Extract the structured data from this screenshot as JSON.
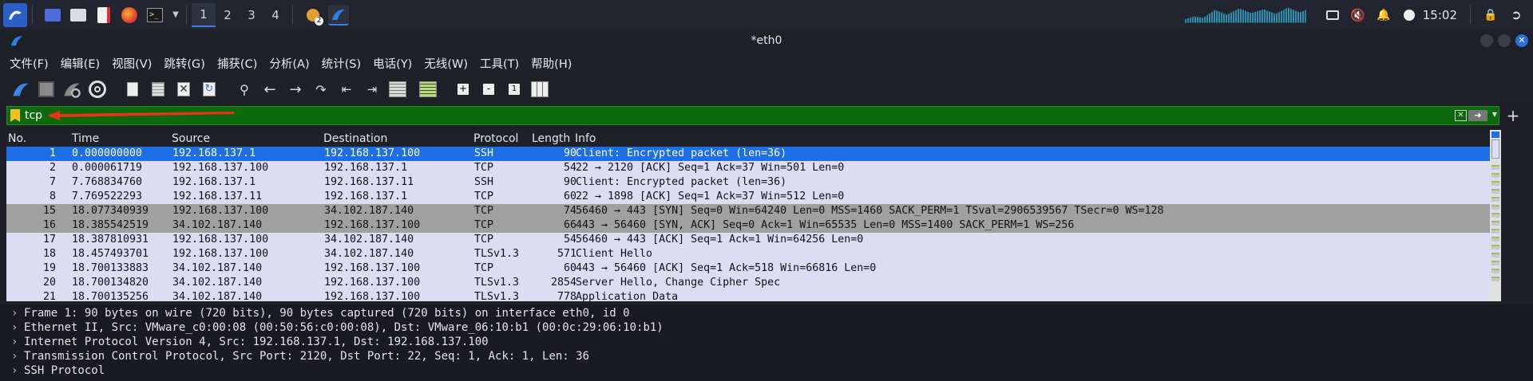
{
  "taskbar": {
    "workspaces": [
      "1",
      "2",
      "3",
      "4"
    ],
    "clock": "15:02",
    "notify_badge": "2"
  },
  "window": {
    "title": "*eth0"
  },
  "menu": [
    "文件(F)",
    "编辑(E)",
    "视图(V)",
    "跳转(G)",
    "捕获(C)",
    "分析(A)",
    "统计(S)",
    "电话(Y)",
    "无线(W)",
    "工具(T)",
    "帮助(H)"
  ],
  "filter": {
    "value": "tcp"
  },
  "columns": [
    "No.",
    "Time",
    "Source",
    "Destination",
    "Protocol",
    "Length",
    "Info"
  ],
  "packets": [
    {
      "no": "1",
      "time": "0.000000000",
      "src": "192.168.137.1",
      "dst": "192.168.137.100",
      "proto": "SSH",
      "len": "90",
      "info": "Client: Encrypted packet (len=36)"
    },
    {
      "no": "2",
      "time": "0.000061719",
      "src": "192.168.137.100",
      "dst": "192.168.137.1",
      "proto": "TCP",
      "len": "54",
      "info": "22 → 2120 [ACK] Seq=1 Ack=37 Win=501 Len=0"
    },
    {
      "no": "7",
      "time": "7.768834760",
      "src": "192.168.137.1",
      "dst": "192.168.137.11",
      "proto": "SSH",
      "len": "90",
      "info": "Client: Encrypted packet (len=36)"
    },
    {
      "no": "8",
      "time": "7.769522293",
      "src": "192.168.137.11",
      "dst": "192.168.137.1",
      "proto": "TCP",
      "len": "60",
      "info": "22 → 1898 [ACK] Seq=1 Ack=37 Win=512 Len=0"
    },
    {
      "no": "15",
      "time": "18.077340939",
      "src": "192.168.137.100",
      "dst": "34.102.187.140",
      "proto": "TCP",
      "len": "74",
      "info": "56460 → 443 [SYN] Seq=0 Win=64240 Len=0 MSS=1460 SACK_PERM=1 TSval=2906539567 TSecr=0 WS=128"
    },
    {
      "no": "16",
      "time": "18.385542519",
      "src": "34.102.187.140",
      "dst": "192.168.137.100",
      "proto": "TCP",
      "len": "66",
      "info": "443 → 56460 [SYN, ACK] Seq=0 Ack=1 Win=65535 Len=0 MSS=1400 SACK_PERM=1 WS=256"
    },
    {
      "no": "17",
      "time": "18.387810931",
      "src": "192.168.137.100",
      "dst": "34.102.187.140",
      "proto": "TCP",
      "len": "54",
      "info": "56460 → 443 [ACK] Seq=1 Ack=1 Win=64256 Len=0"
    },
    {
      "no": "18",
      "time": "18.457493701",
      "src": "192.168.137.100",
      "dst": "34.102.187.140",
      "proto": "TLSv1.3",
      "len": "571",
      "info": "Client Hello"
    },
    {
      "no": "19",
      "time": "18.700133883",
      "src": "34.102.187.140",
      "dst": "192.168.137.100",
      "proto": "TCP",
      "len": "60",
      "info": "443 → 56460 [ACK] Seq=1 Ack=518 Win=66816 Len=0"
    },
    {
      "no": "20",
      "time": "18.700134820",
      "src": "34.102.187.140",
      "dst": "192.168.137.100",
      "proto": "TLSv1.3",
      "len": "2854",
      "info": "Server Hello, Change Cipher Spec"
    },
    {
      "no": "21",
      "time": "18.700135256",
      "src": "34.102.187.140",
      "dst": "192.168.137.100",
      "proto": "TLSv1.3",
      "len": "778",
      "info": "Application Data"
    }
  ],
  "details": [
    "Frame 1: 90 bytes on wire (720 bits), 90 bytes captured (720 bits) on interface eth0, id 0",
    "Ethernet II, Src: VMware_c0:00:08 (00:50:56:c0:00:08), Dst: VMware_06:10:b1 (00:0c:29:06:10:b1)",
    "Internet Protocol Version 4, Src: 192.168.137.1, Dst: 192.168.137.100",
    "Transmission Control Protocol, Src Port: 2120, Dst Port: 22, Seq: 1, Ack: 1, Len: 36",
    "SSH Protocol"
  ],
  "colors": {
    "selected": "#1c6fe6",
    "filter_ok": "#0c6a0c",
    "row_default": "#dcdcf2",
    "row_gray": "#a0a0a0"
  }
}
